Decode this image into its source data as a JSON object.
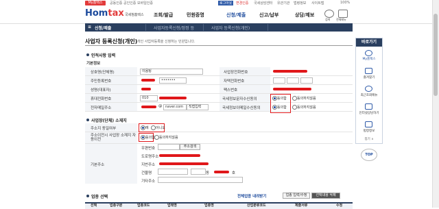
{
  "topbar": {
    "badge": "My홈택스",
    "links": [
      "공동인증",
      "공인인증",
      "모바일인증"
    ],
    "logout": "로그아웃",
    "rlinks": [
      "변경인증",
      "국세상담센터",
      "유관기관",
      "법령정보",
      "사이트맵"
    ],
    "zoom": "100%"
  },
  "header": {
    "logo_a": "Hom",
    "logo_b": "tax",
    "logo_sub": "국세청홈택스",
    "nav": [
      "조회/발급",
      "민원증명",
      "신청/제출",
      "신고/납부",
      "상담/제보"
    ],
    "active_nav": "신청/제출",
    "icons": [
      {
        "name": "search-icon",
        "label": "검색"
      },
      {
        "name": "menu-icon",
        "label": "전체메뉴"
      }
    ]
  },
  "crumbs": {
    "menu": "신청/제출",
    "items": [
      "사업자등록신청/정정 등",
      "사업자 등록신청(개인)"
    ]
  },
  "page": {
    "title": "사업자 등록신청(개인)",
    "subtitle": "개인 사업자등록을 신청하는 민원입니다."
  },
  "section1": {
    "title": "인적사항 입력",
    "sub": "기본정보"
  },
  "fields": {
    "name_label": "상호명(단체명)",
    "name_value": "이음팅",
    "bizphone_label": "사업장전화번호",
    "rrn_label": "주민등록번호",
    "rrn_value": "•••••••",
    "homephone_label": "자택전화번호",
    "rep_label": "성명(대표자)",
    "fax_label": "팩스번호",
    "mobile_label": "휴대전화번호",
    "mobile_value": "010",
    "sms_label": "국세정보문자수신동의",
    "email_label": "전자메일주소",
    "email_domain": "naver.com",
    "email_select": "직접입력",
    "email_agree_label": "국세정보이메일수신동의",
    "agree": "동의함",
    "disagree": "동의하지않음"
  },
  "section2": {
    "title": "사업장(단체) 소재지",
    "same_label": "주소지 동일여부",
    "yes": "예",
    "no": "아니오",
    "transfer_label": "주소이전시 사업장 소재지 자동이전",
    "agree": "동의함",
    "disagree": "동의하지않음",
    "addr_label": "기본주소",
    "zip_label": "우편번호",
    "zip_btn": "주소검색",
    "road_label": "도로명주소",
    "jibun_label": "지번주소",
    "bldg_label": "건물명",
    "dong": "동",
    "ho": "호",
    "etc_label": "기타주소"
  },
  "section3": {
    "title": "업종 선택",
    "link": "전체업종 내려받기",
    "buttons": [
      "업종 입력/수정",
      "선택내용 삭제"
    ],
    "columns": [
      "선택",
      "업종구분",
      "업종코드",
      "업태명",
      "업종명",
      "산업분류코드",
      "제출서류",
      "수정"
    ]
  },
  "rpanel": {
    "title": "바로가기",
    "items": [
      {
        "icon": "user-icon",
        "label": "My홈택스"
      },
      {
        "icon": "star-icon",
        "label": "즐겨찾기"
      },
      {
        "icon": "clock-icon",
        "label": "최근조회메뉴"
      },
      {
        "icon": "chat-icon",
        "label": "인터넷상담하기"
      },
      {
        "icon": "book-icon",
        "label": "법령정보"
      }
    ],
    "fold": "접기 ∧",
    "top": "TOP"
  }
}
